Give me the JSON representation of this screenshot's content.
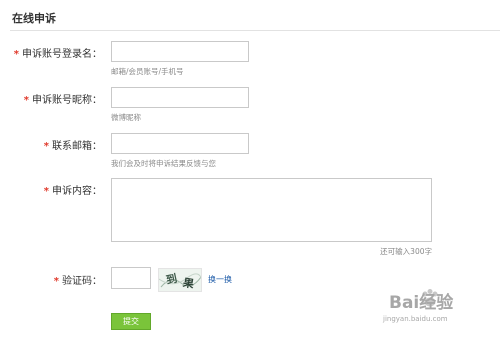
{
  "page": {
    "title": "在线申诉"
  },
  "form": {
    "required_mark": "*",
    "login_name": {
      "label": "申诉账号登录名：",
      "value": "",
      "hint": "邮箱/会员账号/手机号"
    },
    "nickname": {
      "label": "申诉账号昵称：",
      "value": "",
      "hint": "微博昵称"
    },
    "email": {
      "label": "联系邮箱：",
      "value": "",
      "hint": "我们会及时将申诉结果反馈与您"
    },
    "content": {
      "label": "申诉内容：",
      "value": "",
      "counter": "还可输入300字"
    },
    "captcha": {
      "label": "验证码：",
      "value": "",
      "image_text": "到果",
      "refresh_label": "换一换"
    },
    "submit_label": "提交"
  },
  "watermark": {
    "brand": "Bai经验",
    "url": "jingyan.baidu.com"
  },
  "colors": {
    "required": "#e0392b",
    "link": "#1d5ba8",
    "submit_bg": "#7ac43a",
    "border": "#c9c9c9"
  }
}
